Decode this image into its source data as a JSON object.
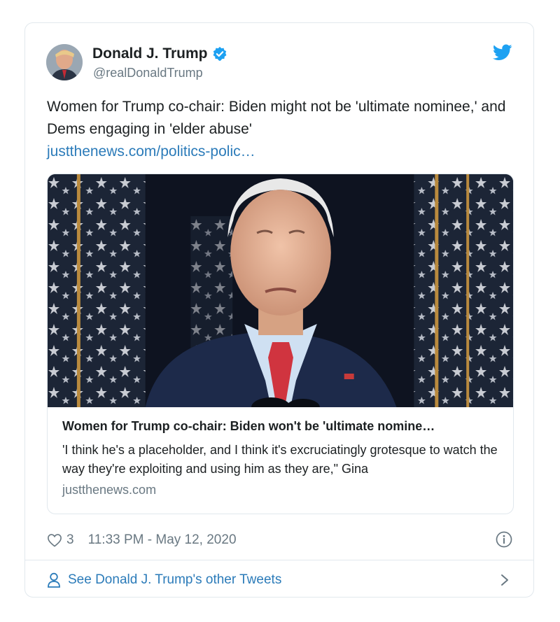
{
  "tweet": {
    "display_name": "Donald J. Trump",
    "handle": "@realDonaldTrump",
    "verified": true,
    "text": "Women for Trump co-chair: Biden might not be 'ultimate nominee,' and Dems engaging in 'elder abuse'",
    "link": "justthenews.com/politics-polic…",
    "likes": "3",
    "timestamp": "11:33 PM - May 12, 2020"
  },
  "card": {
    "title": "Women for Trump co-chair: Biden won't be 'ultimate nomine…",
    "description": "'I think he's a placeholder, and I think it's excruciatingly grotesque to watch the way they're exploiting and using him as they are,\" Gina",
    "domain": "justthenews.com"
  },
  "footer": {
    "label": "See Donald J. Trump's other Tweets"
  },
  "colors": {
    "link": "#2b7bb9",
    "verified": "#1da1f2",
    "muted": "#697882",
    "border": "#e1e8ed"
  },
  "icons": [
    "twitter-bird-icon",
    "verified-badge-icon",
    "heart-icon",
    "info-icon",
    "person-icon",
    "chevron-right-icon"
  ]
}
